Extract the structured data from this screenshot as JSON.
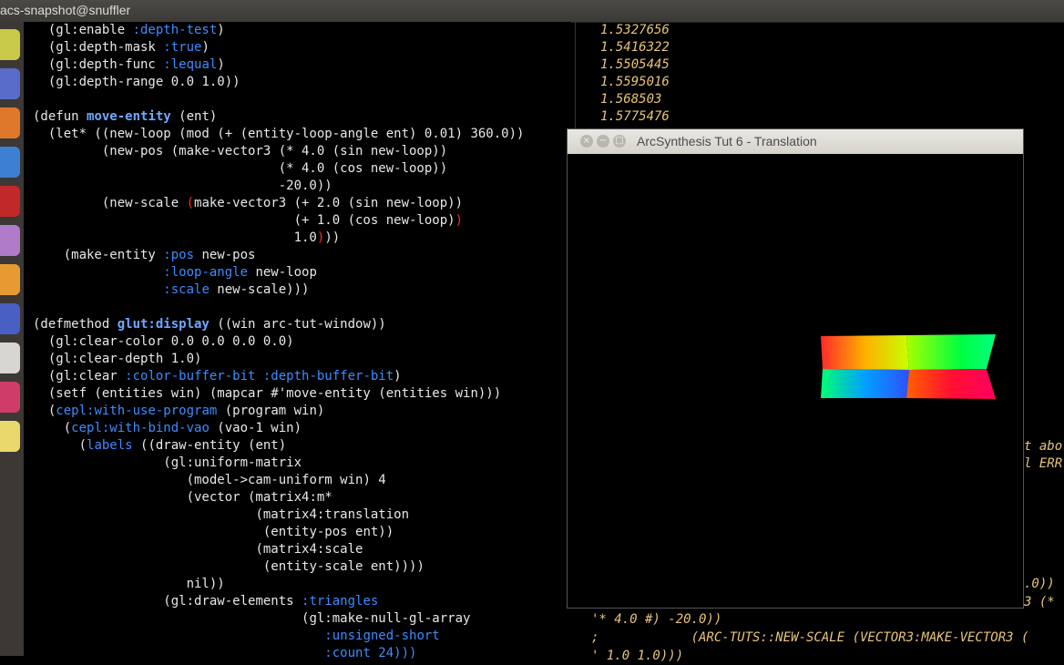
{
  "topbar": {
    "title": "acs-snapshot@snuffler"
  },
  "launcher": {
    "icons": [
      {
        "name": "dash-icon",
        "color": "#c9c94a"
      },
      {
        "name": "editor-icon",
        "color": "#5a6cc9"
      },
      {
        "name": "files-icon",
        "color": "#e0782c"
      },
      {
        "name": "software-icon",
        "color": "#3d7fd1"
      },
      {
        "name": "presentation-icon",
        "color": "#c0282a"
      },
      {
        "name": "pidgin-icon",
        "color": "#b07bc9"
      },
      {
        "name": "firefox-icon",
        "color": "#e89a32"
      },
      {
        "name": "inkscape-icon",
        "color": "#4a5fc4"
      },
      {
        "name": "text-icon",
        "color": "#d8d6d2"
      },
      {
        "name": "help-icon",
        "color": "#d03c6a"
      },
      {
        "name": "notes-icon",
        "color": "#e9d96b"
      }
    ]
  },
  "editor": {
    "lines": [
      [
        "  ",
        {
          "t": "(gl:enable "
        },
        {
          "t": ":depth-test",
          "c": "kw"
        },
        {
          "t": ")"
        }
      ],
      [
        "  ",
        {
          "t": "(gl:depth-mask "
        },
        {
          "t": ":true",
          "c": "kw"
        },
        {
          "t": ")"
        }
      ],
      [
        "  ",
        {
          "t": "(gl:depth-func "
        },
        {
          "t": ":lequal",
          "c": "kw"
        },
        {
          "t": ")"
        }
      ],
      [
        "  ",
        {
          "t": "(gl:depth-range 0.0 1.0))"
        }
      ],
      [
        ""
      ],
      [
        "",
        {
          "t": "(defun "
        },
        {
          "t": "move-entity",
          "c": "fn"
        },
        {
          "t": " (ent)"
        }
      ],
      [
        "  ",
        {
          "t": "(let* ((new-loop (mod (+ (entity-loop-angle ent) 0.01) 360.0))"
        }
      ],
      [
        "         ",
        {
          "t": "(new-pos (make-vector3 (* 4.0 (sin new-loop))"
        }
      ],
      [
        "                                ",
        {
          "t": "(* 4.0 (cos new-loop))"
        }
      ],
      [
        "                                ",
        {
          "t": "-20.0))"
        }
      ],
      [
        "         ",
        {
          "t": "(new-scale "
        },
        {
          "t": "(",
          "c": "paren-hl"
        },
        {
          "t": "make-vector3 (+ 2.0 (sin new-loop))"
        }
      ],
      [
        "                                  ",
        {
          "t": "(+ 1.0 (cos new-loop)"
        },
        {
          "t": ")",
          "c": "paren-hl"
        }
      ],
      [
        "                                  ",
        {
          "t": "1.0"
        },
        {
          "t": ")",
          "c": "paren-hl"
        },
        {
          "t": "))"
        }
      ],
      [
        "    ",
        {
          "t": "(make-entity "
        },
        {
          "t": ":pos",
          "c": "kw"
        },
        {
          "t": " new-pos"
        }
      ],
      [
        "                 ",
        {
          "t": ":loop-angle",
          "c": "kw"
        },
        {
          "t": " new-loop"
        }
      ],
      [
        "                 ",
        {
          "t": ":scale",
          "c": "kw"
        },
        {
          "t": " new-scale)))"
        }
      ],
      [
        ""
      ],
      [
        "",
        {
          "t": "(defmethod "
        },
        {
          "t": "glut:display",
          "c": "fn"
        },
        {
          "t": " ((win arc-tut-window))"
        }
      ],
      [
        "  ",
        {
          "t": "(gl:clear-color 0.0 0.0 0.0 0.0)"
        }
      ],
      [
        "  ",
        {
          "t": "(gl:clear-depth 1.0)"
        }
      ],
      [
        "  ",
        {
          "t": "(gl:clear "
        },
        {
          "t": ":color-buffer-bit :depth-buffer-bit",
          "c": "kw"
        },
        {
          "t": ")"
        }
      ],
      [
        "  ",
        {
          "t": "(setf (entities win) (mapcar #'move-entity (entities win)))"
        }
      ],
      [
        "  ",
        {
          "t": "("
        },
        {
          "t": "cepl:with-use-program",
          "c": "kw"
        },
        {
          "t": " (program win)"
        }
      ],
      [
        "    ",
        {
          "t": "("
        },
        {
          "t": "cepl:with-bind-vao",
          "c": "kw"
        },
        {
          "t": " (vao-1 win)"
        }
      ],
      [
        "      ",
        {
          "t": "("
        },
        {
          "t": "labels",
          "c": "kw"
        },
        {
          "t": " ((draw-entity (ent)"
        }
      ],
      [
        "                 ",
        {
          "t": "(gl:uniform-matrix"
        }
      ],
      [
        "                    ",
        {
          "t": "(model->cam-uniform win) 4"
        }
      ],
      [
        "                    ",
        {
          "t": "(vector (matrix4:m*"
        }
      ],
      [
        "                             ",
        {
          "t": "(matrix4:translation"
        }
      ],
      [
        "                              ",
        {
          "t": "(entity-pos ent))"
        }
      ],
      [
        "                             ",
        {
          "t": "(matrix4:scale"
        }
      ],
      [
        "                              ",
        {
          "t": "(entity-scale ent))))"
        }
      ],
      [
        "                    ",
        {
          "t": "nil))"
        }
      ],
      [
        "                 ",
        {
          "t": "(gl:draw-elements "
        },
        {
          "t": ":triangles",
          "c": "kw"
        }
      ],
      [
        "                                   ",
        {
          "t": "(gl:make-null-gl-array"
        }
      ],
      [
        "                                      ",
        {
          "t": ":unsigned-short",
          "c": "kw"
        }
      ],
      [
        "                                      ",
        {
          "t": ":count 24)))",
          "c": "kw"
        }
      ]
    ]
  },
  "repl": {
    "numbers": [
      "1.5327656",
      "1.5416322",
      "1.5505445",
      "1.5595016",
      "1.568503",
      "1.5775476"
    ],
    "bottom_lines": [
      "'* 4.0 #) -20.0))",
      ";            (ARC-TUTS::NEW-SCALE (VECTOR3:MAKE-VECTOR3 (",
      "' 1.0 1.0)))"
    ],
    "right_fragments": [
      "t abo",
      "l ERR",
      ".0))",
      "3 (*"
    ]
  },
  "gl_window": {
    "title": "ArcSynthesis Tut 6 - Translation",
    "close_glyph": "×",
    "min_glyph": "−",
    "max_glyph": "□"
  }
}
